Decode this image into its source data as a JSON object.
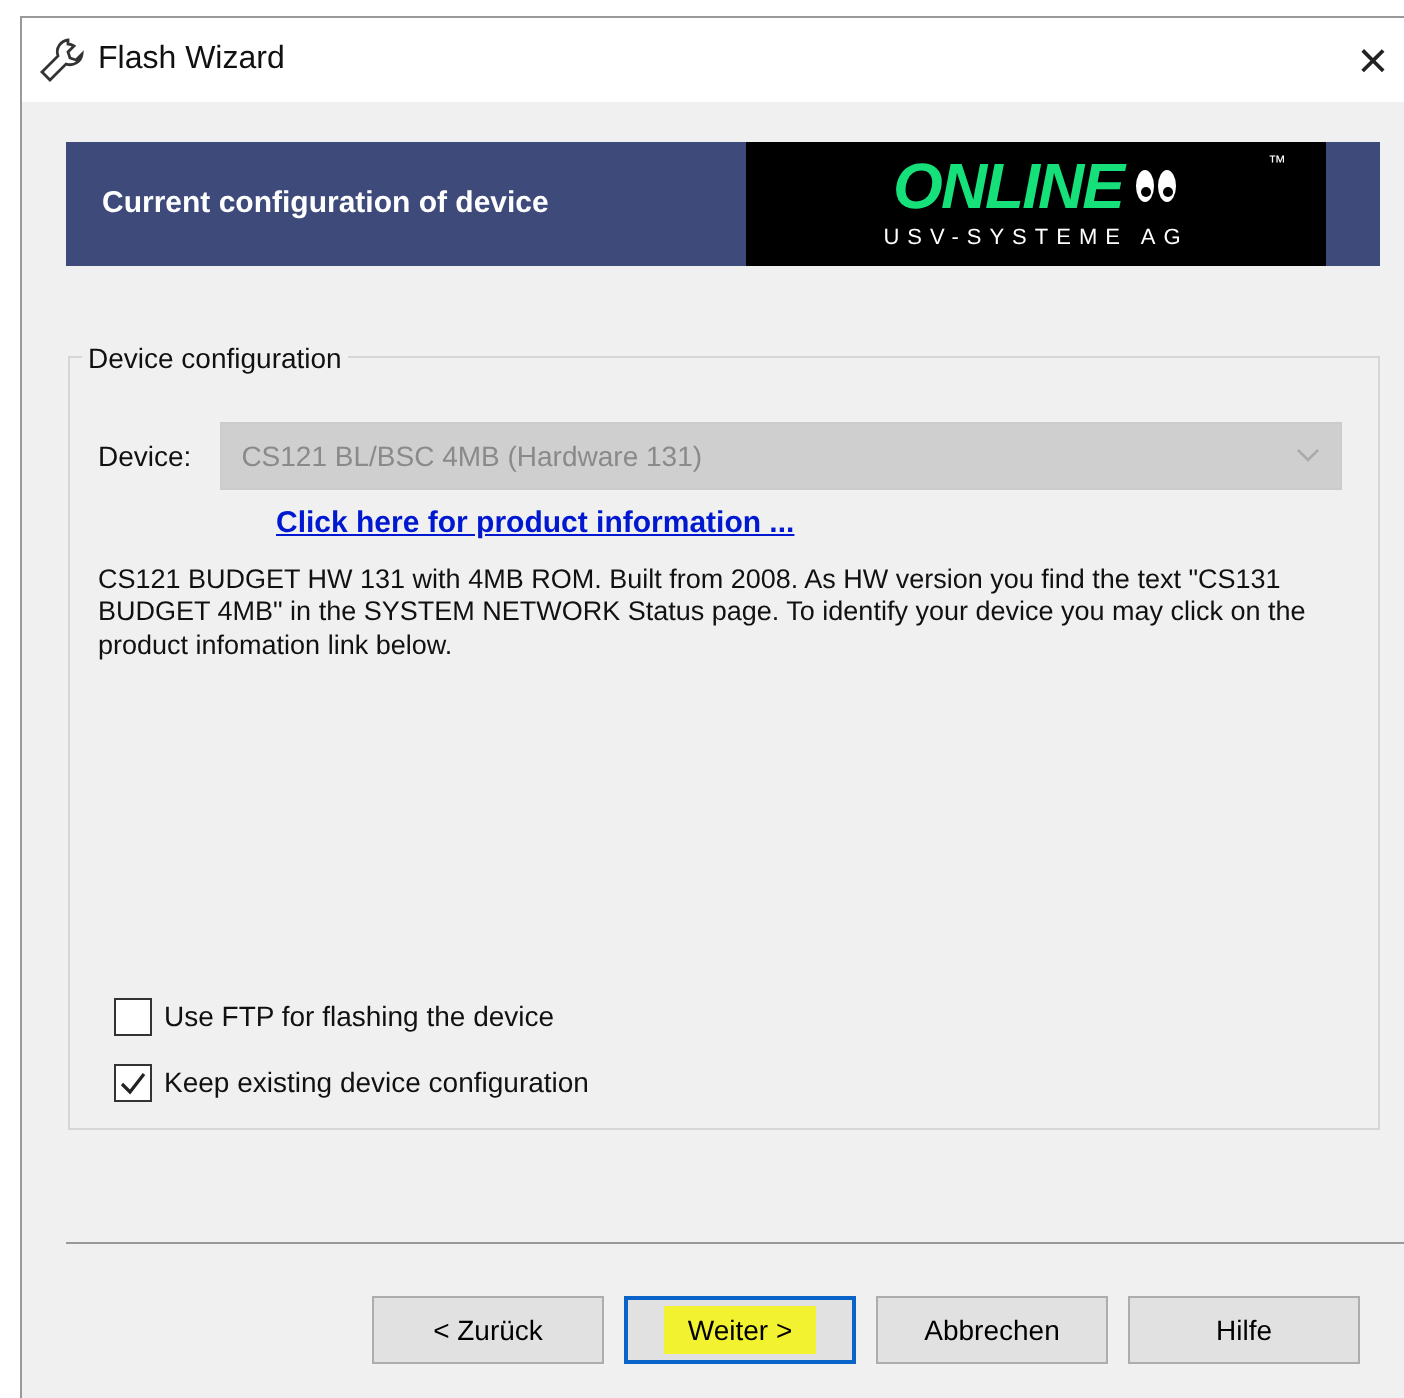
{
  "window": {
    "title": "Flash Wizard",
    "close": "×"
  },
  "header": {
    "title": "Current configuration of device",
    "logo": {
      "brand": "ONLINE",
      "trademark": "™",
      "subtitle": "USV-SYSTEME AG"
    }
  },
  "group": {
    "title": "Device configuration",
    "device": {
      "label": "Device:",
      "value": "CS121 BL/BSC 4MB (Hardware 131)",
      "disabled": true
    },
    "link": "Click here for product information ...",
    "description": "CS121 BUDGET HW 131 with 4MB ROM. Built from 2008. As HW version you find the text \"CS131 BUDGET 4MB\" in the SYSTEM  NETWORK Status page. To identify your device you may click on the product infomation link below.",
    "options": [
      {
        "label": "Use FTP for flashing the device",
        "checked": false
      },
      {
        "label": "Keep existing device configuration",
        "checked": true
      }
    ]
  },
  "buttons": [
    {
      "label": "< Zurück",
      "default": false,
      "highlighted": false
    },
    {
      "label": "Weiter >",
      "default": true,
      "highlighted": true
    },
    {
      "label": "Abbrechen",
      "default": false,
      "highlighted": false
    },
    {
      "label": "Hilfe",
      "default": false,
      "highlighted": false
    }
  ]
}
